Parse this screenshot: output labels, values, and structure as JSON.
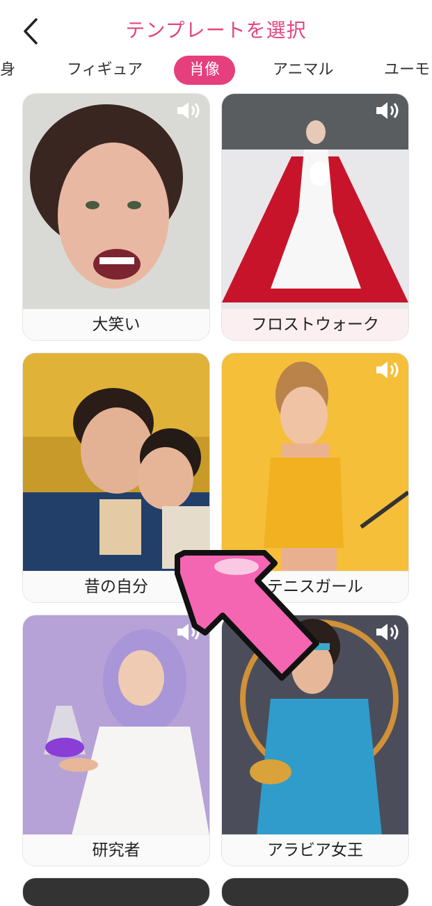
{
  "header": {
    "title": "テンプレートを選択"
  },
  "tabs": [
    {
      "label": "全身",
      "active": false
    },
    {
      "label": "フィギュア",
      "active": false
    },
    {
      "label": "肖像",
      "active": true
    },
    {
      "label": "アニマル",
      "active": false
    },
    {
      "label": "ユーモ",
      "active": false
    }
  ],
  "templates": [
    {
      "label": "大笑い"
    },
    {
      "label": "フロストウォーク"
    },
    {
      "label": "昔の自分"
    },
    {
      "label": "テニスガール"
    },
    {
      "label": "研究者"
    },
    {
      "label": "アラビア女王"
    }
  ],
  "colors": {
    "accent": "#e63f7d",
    "title": "#e2467f"
  }
}
